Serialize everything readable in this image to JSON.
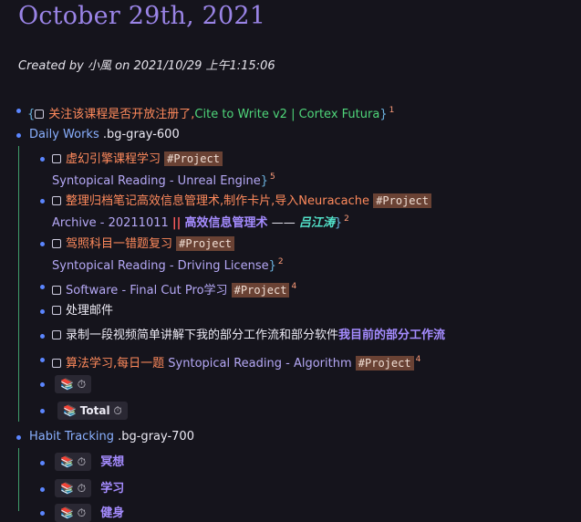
{
  "page": {
    "title": "October 29th, 2021",
    "meta": {
      "created_by_label": "Created by",
      "author": "小風",
      "on_label": "on",
      "created_at": "2021/10/29 上午1:15:06"
    }
  },
  "colors": {
    "accent": "#9a84e6",
    "bullet": "#5b86ff",
    "tag_bg": "#6a4234",
    "thread": "#3f9d6a"
  },
  "blocks": {
    "course": {
      "text": "关注该课程是否开放注册了,",
      "link": "Cite to Write v2 | Cortex Futura",
      "ref_count": "1"
    },
    "daily_works": {
      "label": "Daily Works",
      "class_name": ".bg-gray-600"
    },
    "unreal": {
      "text": "虚幻引擎课程学习",
      "tag": "#Project",
      "link": "Syntopical Reading - Unreal Engine",
      "ref_count": "5"
    },
    "archive": {
      "text": "整理归档笔记高效信息管理术,制作卡片,导入Neuracache",
      "tag": "#Project",
      "link": "Archive - 20211011",
      "separator": "||",
      "book": "高效信息管理术",
      "dash": "——",
      "author": "吕江涛",
      "ref_count": "2"
    },
    "driving": {
      "text": "驾照科目一错题复习",
      "tag": "#Project",
      "link": "Syntopical Reading - Driving License",
      "ref_count": "2"
    },
    "finalcut": {
      "text": "Software - Final Cut Pro学习",
      "tag": "#Project",
      "ref_count": "4"
    },
    "mail": {
      "text": "处理邮件"
    },
    "video": {
      "text": "录制一段视频简单讲解下我的部分工作流和部分软件",
      "link": "我目前的部分工作流"
    },
    "algorithm": {
      "text": "算法学习,每日一题",
      "link": "Syntopical Reading - Algorithm",
      "tag": "#Project",
      "ref_count": "4"
    },
    "timer_button": {
      "icon1": "📚",
      "icon2": "⏱"
    },
    "total_button": {
      "icon1": "📚",
      "label": "Total",
      "icon2": "⏱"
    },
    "habit": {
      "label": "Habit Tracking",
      "class_name": ".bg-gray-700"
    },
    "meditate": {
      "icon1": "📚",
      "icon2": "⏱",
      "label": "冥想"
    },
    "study": {
      "icon1": "📚",
      "icon2": "⏱",
      "label": "学习"
    },
    "partial": {
      "icon1": "📚",
      "icon2": "⏱",
      "label": "健身"
    }
  }
}
